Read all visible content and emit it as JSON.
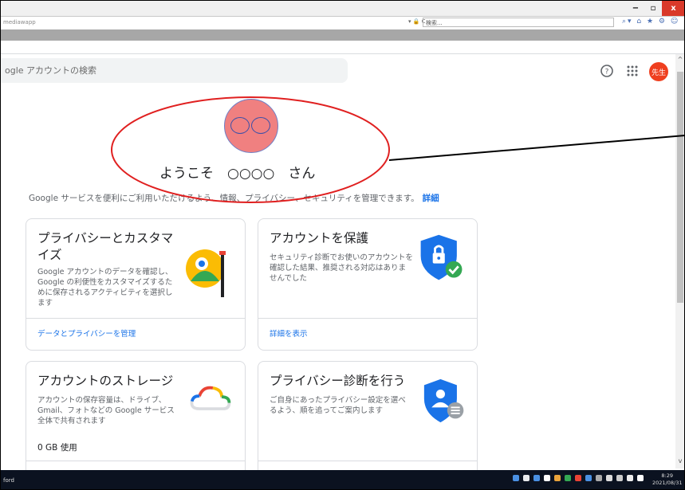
{
  "browser": {
    "url": "mediawapp",
    "search_placeholder": "検索...",
    "window_controls": {
      "minimize": "−",
      "restore": "▫",
      "close": "x"
    }
  },
  "header": {
    "search_placeholder": "ogle アカウントの検索",
    "avatar_label": "先生"
  },
  "welcome": {
    "greeting": "ようこそ　○○○○　さん",
    "subtitle": "Google サービスを便利にご利用いただけるよう、情報、プライバシー、セキュリティを管理できます。",
    "subtitle_link": "詳細"
  },
  "cards": {
    "privacy": {
      "title": "プライバシーとカスタマイズ",
      "desc": "Google アカウントのデータを確認し、Google の利便性をカスタマイズするために保存されるアクティビティを選択します",
      "link": "データとプライバシーを管理"
    },
    "security": {
      "title": "アカウントを保護",
      "desc": "セキュリティ診断でお使いのアカウントを確認した結果、推奨される対応はありませんでした",
      "link": "詳細を表示"
    },
    "storage": {
      "title": "アカウントのストレージ",
      "desc": "アカウントの保存容量は、ドライブ、Gmail、フォトなどの Google サービス全体で共有されます",
      "value": "0 GB 使用"
    },
    "checkup": {
      "title": "プライバシー診断を行う",
      "desc": "ご自身にあったプライバシー設定を選べるよう、順を追ってご案内します"
    }
  },
  "taskbar": {
    "left_label": "ford",
    "time": "8:29",
    "date": "2021/08/31"
  },
  "colors": {
    "annotation": "#e02020",
    "avatar": "#ef3f1f",
    "link": "#1a73e8",
    "shield": "#1a73e8",
    "check": "#34a853"
  }
}
